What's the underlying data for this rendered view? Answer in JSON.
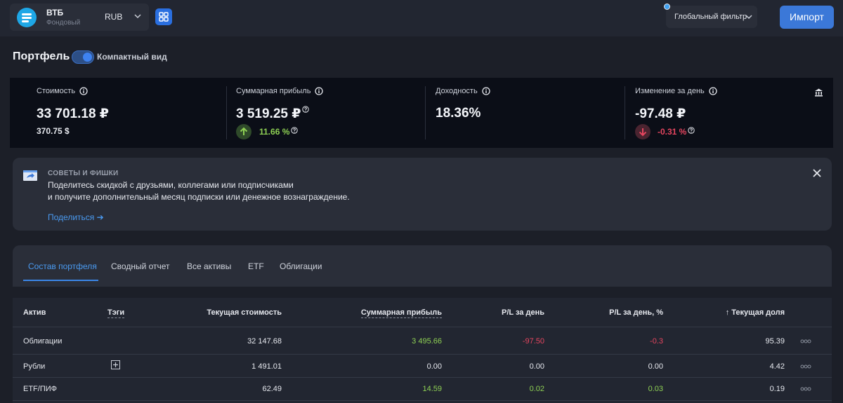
{
  "header": {
    "broker_name": "ВТБ",
    "broker_type": "Фондовый",
    "currency": "RUB",
    "filter_label": "Глобальный фильтр",
    "import_label": "Импорт"
  },
  "portfolio": {
    "title": "Портфель",
    "compact_label": "Компактный вид",
    "compact_on": true
  },
  "stats": {
    "value": {
      "label": "Стоимость",
      "main": "33 701.18 ₽",
      "sub": "370.75 $"
    },
    "profit": {
      "label": "Суммарная прибыль",
      "main": "3 519.25 ₽",
      "percent": "11.66 %"
    },
    "yield": {
      "label": "Доходность",
      "main": "18.36%"
    },
    "day_change": {
      "label": "Изменение за день",
      "main": "-97.48 ₽",
      "percent": "-0.31 %"
    }
  },
  "tips": {
    "title": "СОВЕТЫ И ФИШКИ",
    "line1": "Поделитесь скидкой с друзьями, коллегами или подписчиками",
    "line2": "и получите дополнительный месяц подписки или денежное вознаграждение.",
    "link": "Поделиться ➔"
  },
  "tabs": [
    "Состав портфеля",
    "Сводный отчет",
    "Все активы",
    "ETF",
    "Облигации"
  ],
  "table": {
    "headers": {
      "asset": "Актив",
      "tags": "Тэги",
      "current_value": "Текущая стоимость",
      "total_profit": "Суммарная прибыль",
      "pl_day": "P/L за день",
      "pl_day_pct": "P/L за день, %",
      "share": "↑ Текущая доля"
    },
    "rows": [
      {
        "asset": "Облигации",
        "current_value": "32 147.68",
        "total_profit": "3 495.66",
        "pl_day": "-97.50",
        "pl_day_pct": "-0.3",
        "share": "95.39"
      },
      {
        "asset": "Рубли",
        "current_value": "1 491.01",
        "total_profit": "0.00",
        "pl_day": "0.00",
        "pl_day_pct": "0.00",
        "share": "4.42"
      },
      {
        "asset": "ETF/ПИФ",
        "current_value": "62.49",
        "total_profit": "14.59",
        "pl_day": "0.02",
        "pl_day_pct": "0.03",
        "share": "0.19"
      }
    ]
  },
  "colors": {
    "accent": "#3b78d8",
    "positive": "#8fd154",
    "negative": "#e5455f",
    "link": "#4a9af0"
  }
}
